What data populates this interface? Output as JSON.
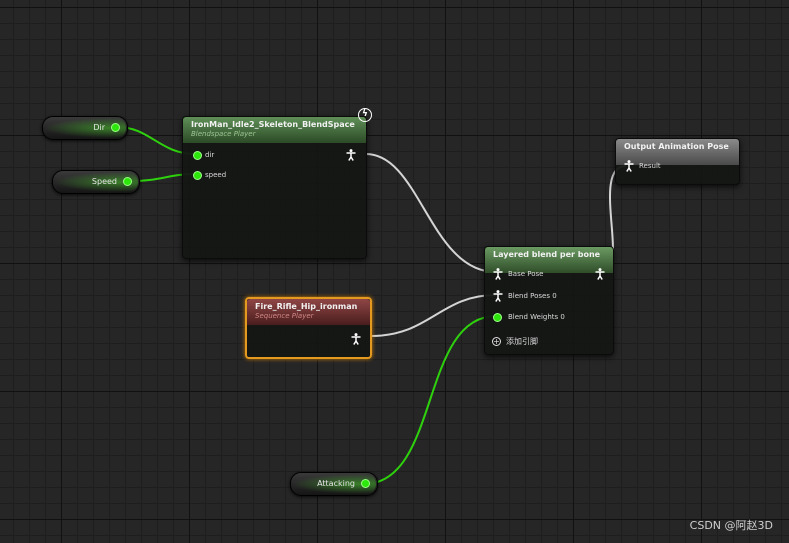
{
  "variables": {
    "dir": "Dir",
    "speed": "Speed",
    "attacking": "Attacking"
  },
  "blendspace_node": {
    "title": "IronMan_Idle2_Skeleton_BlendSpace",
    "subtitle": "Blendspace Player",
    "pin_dir": "dir",
    "pin_speed": "speed",
    "badge_icon": "lightning-icon"
  },
  "sequence_node": {
    "title": "Fire_Rifle_Hip_ironman",
    "subtitle": "Sequence Player"
  },
  "layered_node": {
    "title": "Layered blend per bone",
    "pin_base_pose": "Base Pose",
    "pin_blend_poses": "Blend Poses 0",
    "pin_blend_weights": "Blend Weights 0",
    "add_pin": "添加引脚"
  },
  "output_node": {
    "title": "Output Animation Pose",
    "pin_result": "Result"
  },
  "watermark": "CSDN @阿赵3D",
  "colors": {
    "canvas": "#262626",
    "bool_pin": "#2de60b",
    "pose_wire": "#d8d8d8",
    "selection": "#e39a1e"
  }
}
